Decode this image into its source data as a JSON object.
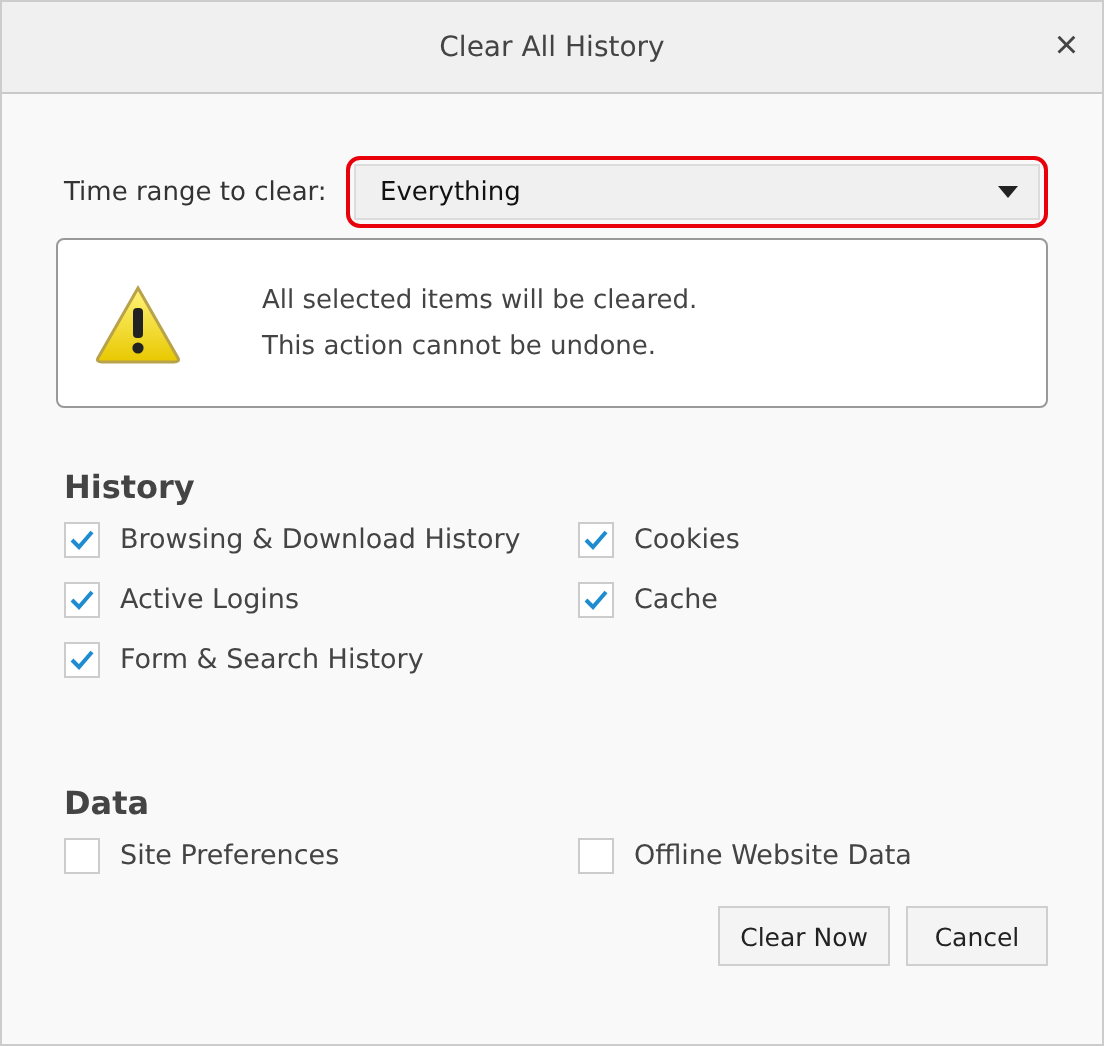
{
  "window": {
    "title": "Clear All History",
    "close": "×"
  },
  "time_range": {
    "label": "Time range to clear:",
    "value": "Everything",
    "highlighted": true
  },
  "warning": {
    "lines": [
      "All selected items will be cleared.",
      "This action cannot be undone."
    ]
  },
  "sections": [
    {
      "heading": "History",
      "items": [
        {
          "label": "Browsing & Download History",
          "checked": true
        },
        {
          "label": "Cookies",
          "checked": true
        },
        {
          "label": "Active Logins",
          "checked": true
        },
        {
          "label": "Cache",
          "checked": true
        },
        {
          "label": "Form & Search History",
          "checked": true
        }
      ]
    },
    {
      "heading": "Data",
      "items": [
        {
          "label": "Site Preferences",
          "checked": false
        },
        {
          "label": "Offline Website Data",
          "checked": false
        }
      ]
    }
  ],
  "buttons": [
    "Clear Now",
    "Cancel"
  ]
}
